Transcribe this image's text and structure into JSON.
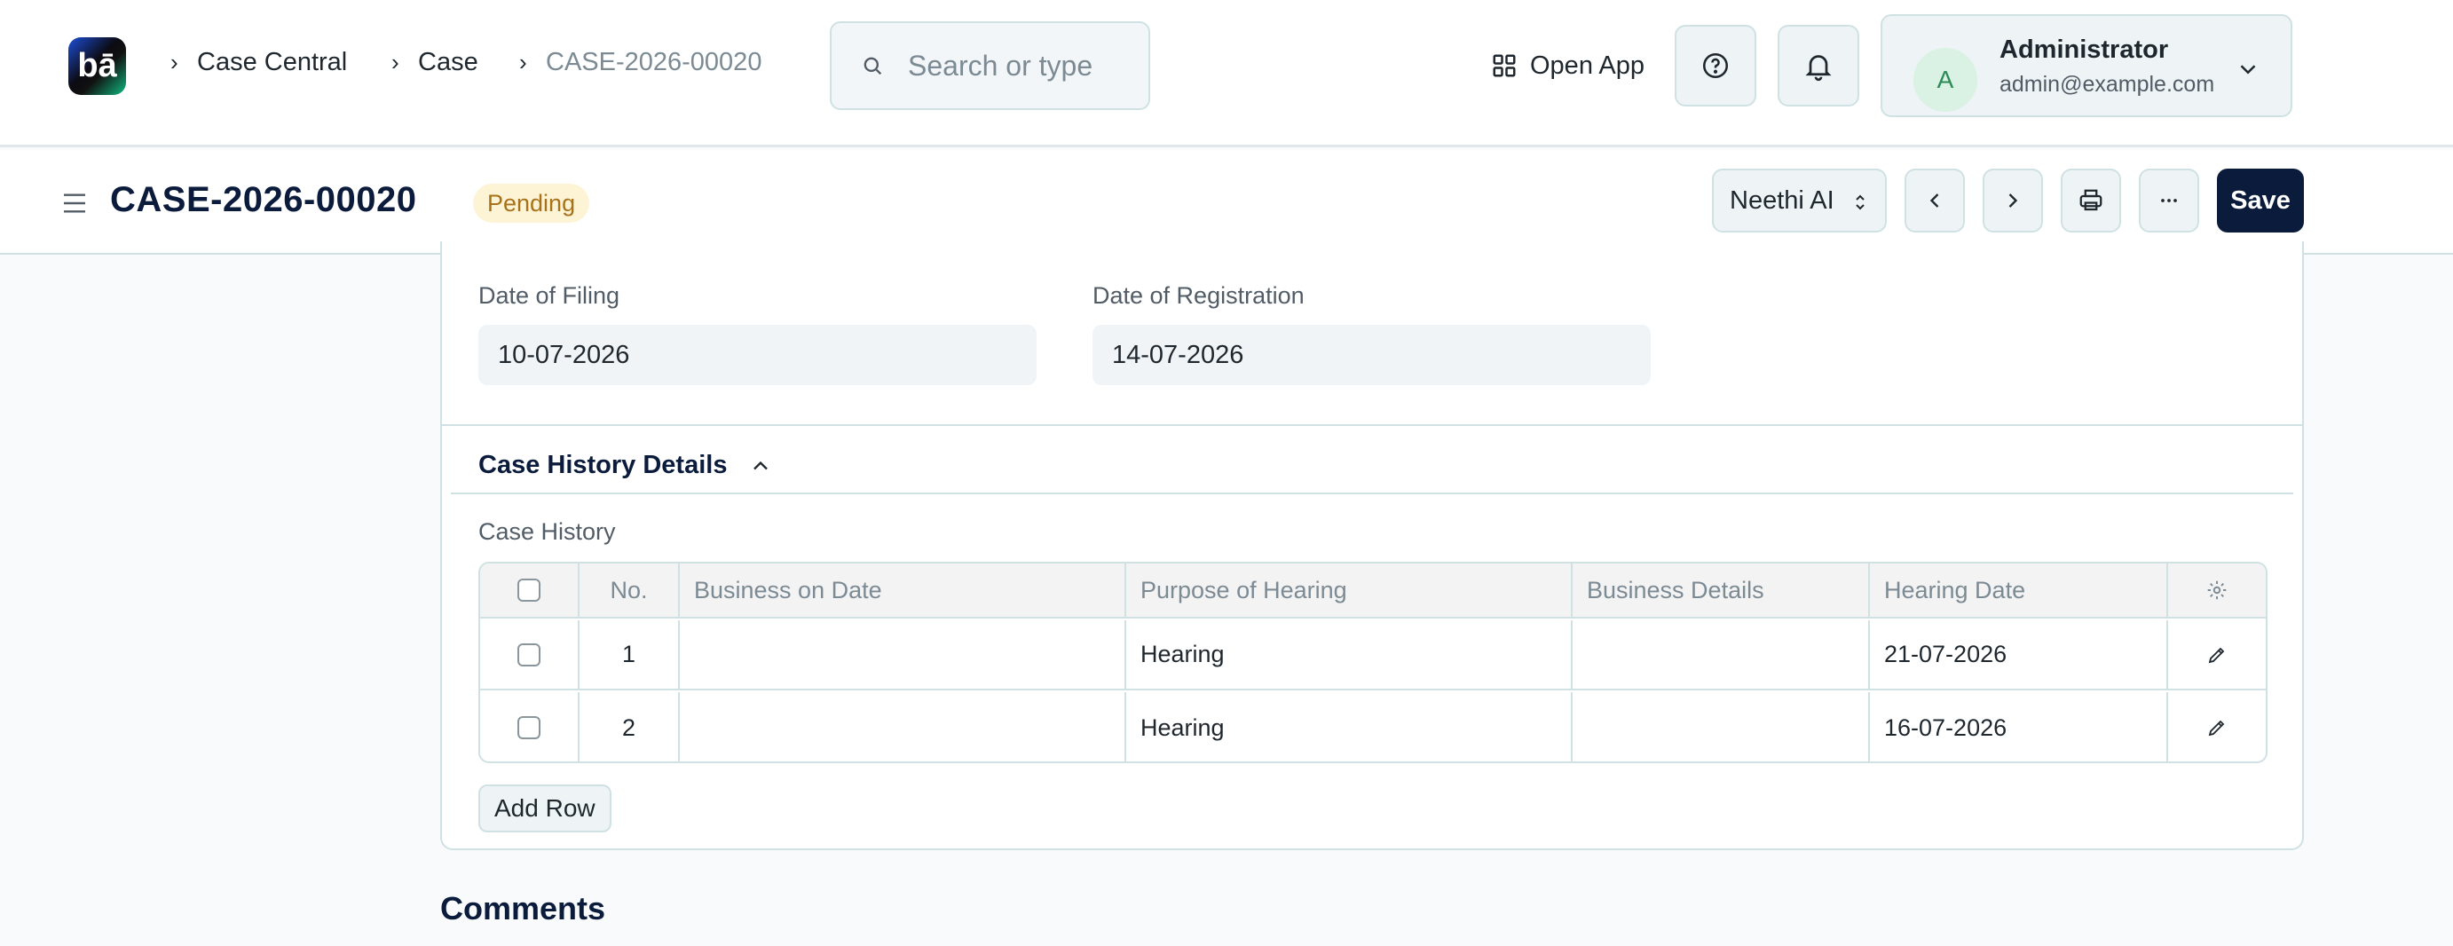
{
  "navbar": {
    "logo_text": "bā",
    "breadcrumbs": [
      "Case Central",
      "Case",
      "CASE-2026-00020"
    ],
    "search_placeholder": "Search or type",
    "open_app_label": "Open App",
    "user": {
      "initial": "A",
      "name": "Administrator",
      "email": "admin@example.com"
    }
  },
  "page_head": {
    "title": "CASE-2026-00020",
    "status": "Pending",
    "ai_select": "Neethi AI",
    "save_label": "Save"
  },
  "form": {
    "date_of_filing_label": "Date of Filing",
    "date_of_filing_value": "10-07-2026",
    "date_of_registration_label": "Date of Registration",
    "date_of_registration_value": "14-07-2026",
    "section_title": "Case History Details",
    "table_label": "Case History",
    "columns": [
      "No.",
      "Business on Date",
      "Purpose of Hearing",
      "Business Details",
      "Hearing Date"
    ],
    "rows": [
      {
        "no": "1",
        "business_on_date": "",
        "purpose": "Hearing",
        "details": "",
        "hearing_date": "21-07-2026"
      },
      {
        "no": "2",
        "business_on_date": "",
        "purpose": "Hearing",
        "details": "",
        "hearing_date": "16-07-2026"
      }
    ],
    "add_row_label": "Add Row"
  },
  "comments_title": "Comments",
  "colors": {
    "primary": "#0b1b3b",
    "badge_bg": "#fdf4d6",
    "badge_text": "#a8721a",
    "border": "#cfe1e3"
  }
}
